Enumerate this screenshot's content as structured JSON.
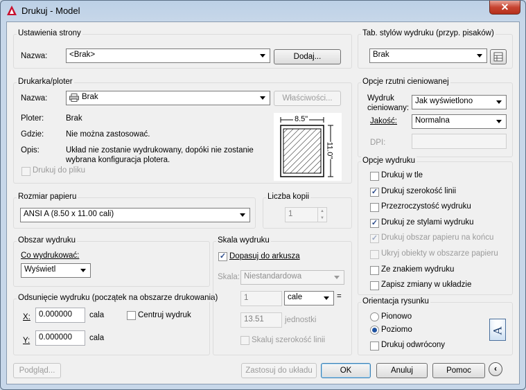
{
  "window": {
    "title": "Drukuj - Model"
  },
  "page_setup": {
    "title": "Ustawienia strony",
    "name_label": "Nazwa:",
    "name_value": "<Brak>",
    "add_button": "Dodaj..."
  },
  "printer": {
    "title": "Drukarka/ploter",
    "name_label": "Nazwa:",
    "name_value": "Brak",
    "properties_button": "Właściwości...",
    "plotter_label": "Ploter:",
    "plotter_value": "Brak",
    "where_label": "Gdzie:",
    "where_value": "Nie można zastosować.",
    "desc_label": "Opis:",
    "desc_line1": "Układ nie zostanie wydrukowany, dopóki nie zostanie",
    "desc_line2": "wybrana konfiguracja plotera.",
    "print_to_file": "Drukuj do pliku",
    "preview_width": "8.5\"",
    "preview_height": "11.0\""
  },
  "paper_size": {
    "title": "Rozmiar papieru",
    "value": "ANSI A (8.50 x 11.00 cali)"
  },
  "copies": {
    "title": "Liczba kopii",
    "value": "1"
  },
  "plot_area": {
    "title": "Obszar wydruku",
    "what_label": "Co wydrukować:",
    "what_value": "Wyświetl"
  },
  "plot_offset": {
    "title": "Odsunięcie wydruku (początek na obszarze drukowania)",
    "x_label": "X:",
    "x_value": "0.000000",
    "x_unit": "cala",
    "y_label": "Y:",
    "y_value": "0.000000",
    "y_unit": "cala",
    "center_label": "Centruj wydruk",
    "center_checked": false
  },
  "plot_scale": {
    "title": "Skala wydruku",
    "fit_label": "Dopasuj do arkusza",
    "fit_checked": true,
    "scale_label": "Skala:",
    "scale_value": "Niestandardowa",
    "val1": "1",
    "unit1": "cale",
    "equals": "=",
    "val2": "13.51",
    "unit2": "jednostki",
    "lineweights_label": "Skaluj szerokość linii"
  },
  "plot_style": {
    "title": "Tab. stylów wydruku (przyp. pisaków)",
    "value": "Brak"
  },
  "shaded": {
    "title": "Opcje rzutni cieniowanej",
    "shade_label_1": "Wydruk",
    "shade_label_2": "cieniowany:",
    "shade_value": "Jak wyświetlono",
    "quality_label": "Jakość:",
    "quality_value": "Normalna",
    "dpi_label": "DPI:",
    "dpi_value": ""
  },
  "plot_options": {
    "title": "Opcje wydruku",
    "items": [
      {
        "label": "Drukuj w tle",
        "checked": false,
        "disabled": false
      },
      {
        "label": "Drukuj szerokość linii",
        "checked": true,
        "disabled": false
      },
      {
        "label": "Przezroczystość wydruku",
        "checked": false,
        "disabled": false
      },
      {
        "label": "Drukuj ze stylami wydruku",
        "checked": true,
        "disabled": false
      },
      {
        "label": "Drukuj obszar papieru na końcu",
        "checked": true,
        "disabled": true
      },
      {
        "label": "Ukryj obiekty w obszarze papieru",
        "checked": false,
        "disabled": true
      },
      {
        "label": "Ze znakiem wydruku",
        "checked": false,
        "disabled": false
      },
      {
        "label": "Zapisz zmiany w układzie",
        "checked": false,
        "disabled": false
      }
    ]
  },
  "orientation": {
    "title": "Orientacja rysunku",
    "portrait": "Pionowo",
    "landscape": "Poziomo",
    "upside_down": "Drukuj odwrócony",
    "selected": "landscape",
    "icon_letter": "A"
  },
  "footer": {
    "preview": "Podgląd...",
    "apply": "Zastosuj do układu",
    "ok": "OK",
    "cancel": "Anuluj",
    "help": "Pomoc"
  },
  "colors": {
    "accent": "#1f52a0",
    "checkmark": "#2a4a8a",
    "disabled_text": "#9b9b9b"
  }
}
